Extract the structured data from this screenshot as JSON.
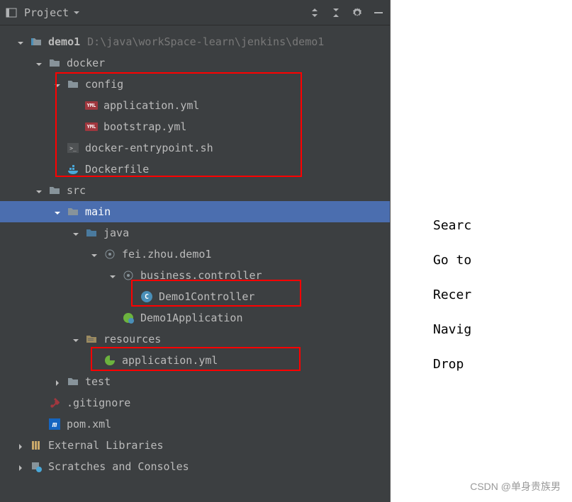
{
  "toolbar": {
    "title": "Project"
  },
  "tree": {
    "root": {
      "name": "demo1",
      "path": "D:\\java\\workSpace-learn\\jenkins\\demo1"
    },
    "docker": "docker",
    "config": "config",
    "app_yml": "application.yml",
    "bootstrap_yml": "bootstrap.yml",
    "entrypoint": "docker-entrypoint.sh",
    "dockerfile": "Dockerfile",
    "src": "src",
    "main": "main",
    "java": "java",
    "pkg": "fei.zhou.demo1",
    "controller_pkg": "business.controller",
    "demo1_controller": "Demo1Controller",
    "demo1_app": "Demo1Application",
    "resources": "resources",
    "res_app_yml": "application.yml",
    "test": "test",
    "gitignore": ".gitignore",
    "pom": "pom.xml",
    "external_libs": "External Libraries",
    "scratches": "Scratches and Consoles"
  },
  "right_panel": {
    "search": "Searc",
    "goto": "Go to",
    "recent": "Recer",
    "navigate": "Navig",
    "drop": "Drop"
  },
  "watermark": "CSDN @单身贵族男"
}
